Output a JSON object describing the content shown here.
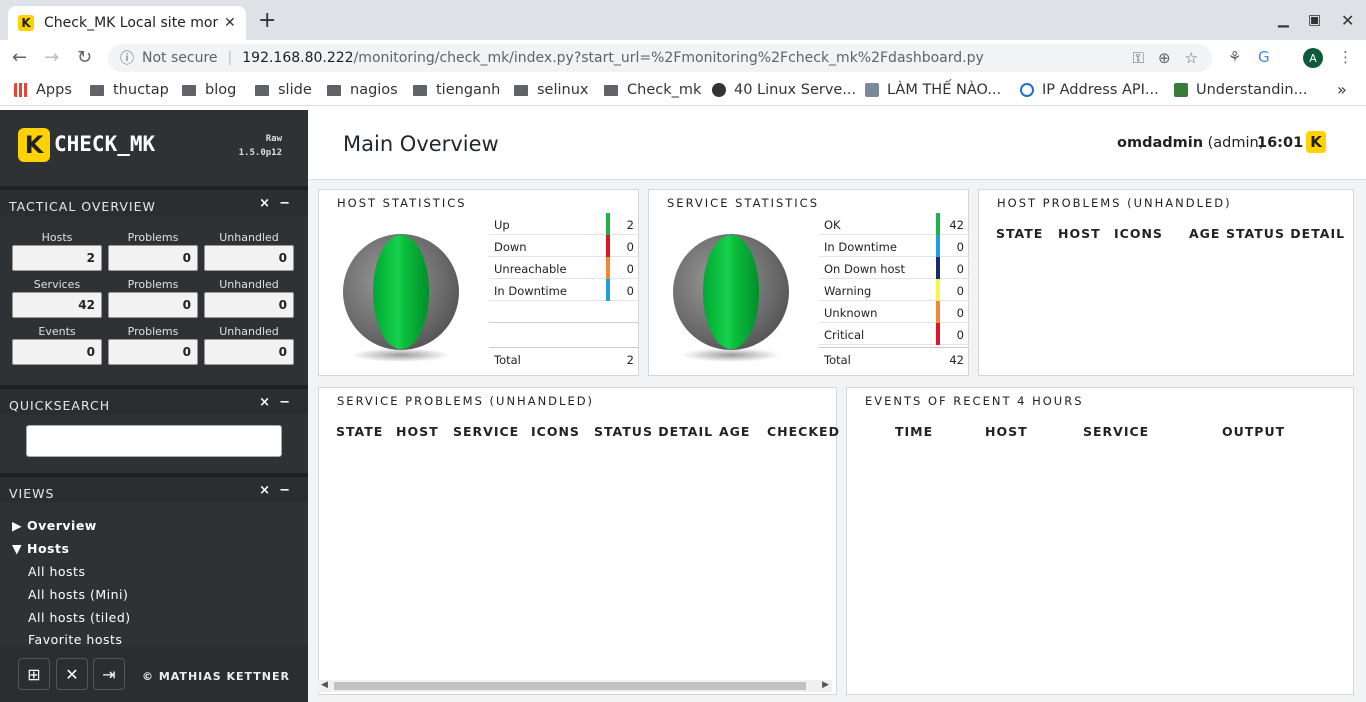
{
  "browser": {
    "tab_title": "Check_MK Local site moni",
    "tab_favicon": "K",
    "not_secure": "Not secure",
    "url_host": "192.168.80.222",
    "url_path": "/monitoring/check_mk/index.py?start_url=%2Fmonitoring%2Fcheck_mk%2Fdashboard.py",
    "avatar": "A",
    "bookmarks": [
      "Apps",
      "thuctap",
      "blog",
      "slide",
      "nagios",
      "tienganh",
      "selinux",
      "Check_mk",
      "40 Linux Serve...",
      "LÀM THẾ NÀO...",
      "IP Address API...",
      "Understandin..."
    ]
  },
  "sidebar": {
    "logo_text": "CHECK_MK",
    "logo_icon": "K",
    "edition": "Raw",
    "version": "1.5.0p12",
    "tactical": {
      "title": "TACTICAL OVERVIEW",
      "close": "×",
      "minimize": "−",
      "rows": [
        {
          "label": "Hosts",
          "value": "2",
          "problems_label": "Problems",
          "problems": "0",
          "unhandled_label": "Unhandled",
          "unhandled": "0"
        },
        {
          "label": "Services",
          "value": "42",
          "problems_label": "Problems",
          "problems": "0",
          "unhandled_label": "Unhandled",
          "unhandled": "0"
        },
        {
          "label": "Events",
          "value": "0",
          "problems_label": "Problems",
          "problems": "0",
          "unhandled_label": "Unhandled",
          "unhandled": "0"
        }
      ]
    },
    "quicksearch": {
      "title": "QUICKSEARCH",
      "close": "×",
      "minimize": "−",
      "value": ""
    },
    "views": {
      "title": "VIEWS",
      "close": "×",
      "minimize": "−",
      "overview": "Overview",
      "hosts": "Hosts",
      "items": [
        "All hosts",
        "All hosts (Mini)",
        "All hosts (tiled)",
        "Favorite hosts"
      ]
    },
    "copyright": "© MATHIAS KETTNER"
  },
  "main": {
    "title": "Main Overview",
    "user": "omdadmin",
    "role": "(admin)",
    "time": "16:01",
    "host_stats": {
      "title": "HOST STATISTICS",
      "rows": [
        {
          "label": "Up",
          "value": "2",
          "color": "#1eb34a"
        },
        {
          "label": "Down",
          "value": "0",
          "color": "#e0142a"
        },
        {
          "label": "Unreachable",
          "value": "0",
          "color": "#f08a32"
        },
        {
          "label": "In Downtime",
          "value": "0",
          "color": "#1e9de8"
        }
      ],
      "total_label": "Total",
      "total": "2"
    },
    "service_stats": {
      "title": "SERVICE STATISTICS",
      "rows": [
        {
          "label": "OK",
          "value": "42",
          "color": "#1eb34a"
        },
        {
          "label": "In Downtime",
          "value": "0",
          "color": "#1e9de8"
        },
        {
          "label": "On Down host",
          "value": "0",
          "color": "#1a2a6b"
        },
        {
          "label": "Warning",
          "value": "0",
          "color": "#f5f54b"
        },
        {
          "label": "Unknown",
          "value": "0",
          "color": "#f08a32"
        },
        {
          "label": "Critical",
          "value": "0",
          "color": "#e0142a"
        }
      ],
      "total_label": "Total",
      "total": "42"
    },
    "host_problems": {
      "title": "HOST PROBLEMS (UNHANDLED)",
      "columns": [
        "STATE",
        "HOST",
        "ICONS",
        "AGE",
        "STATUS DETAIL"
      ]
    },
    "service_problems": {
      "title": "SERVICE PROBLEMS (UNHANDLED)",
      "columns": [
        "STATE",
        "HOST",
        "SERVICE",
        "ICONS",
        "STATUS DETAIL",
        "AGE",
        "CHECKED"
      ]
    },
    "events": {
      "title": "EVENTS OF RECENT 4 HOURS",
      "columns": [
        "TIME",
        "HOST",
        "SERVICE",
        "OUTPUT"
      ]
    }
  }
}
